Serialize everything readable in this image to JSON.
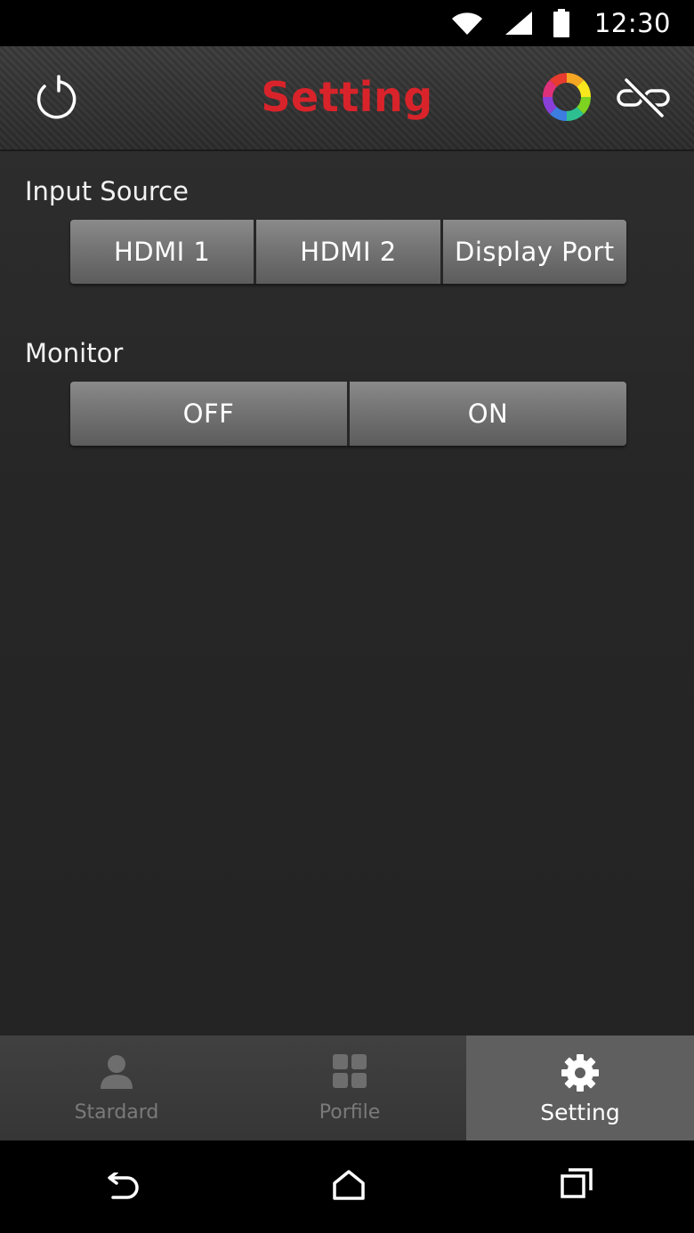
{
  "status_bar": {
    "time": "12:30",
    "icons": [
      "wifi-icon",
      "cell-signal-icon",
      "battery-icon"
    ]
  },
  "header": {
    "title": "Setting",
    "title_color": "#d9232a",
    "left_icon": "refresh-icon",
    "right_icons": [
      "color-wheel-icon",
      "unlink-icon"
    ]
  },
  "input_source": {
    "label": "Input Source",
    "options": [
      "HDMI 1",
      "HDMI 2",
      "Display Port"
    ]
  },
  "monitor": {
    "label": "Monitor",
    "options": [
      "OFF",
      "ON"
    ]
  },
  "tabs": [
    {
      "label": "Stardard",
      "icon": "person-icon",
      "active": false
    },
    {
      "label": "Porfile",
      "icon": "grid-icon",
      "active": false
    },
    {
      "label": "Setting",
      "icon": "gear-icon",
      "active": true
    }
  ],
  "nav_bar": {
    "icons": [
      "back-icon",
      "home-icon",
      "recents-icon"
    ]
  }
}
